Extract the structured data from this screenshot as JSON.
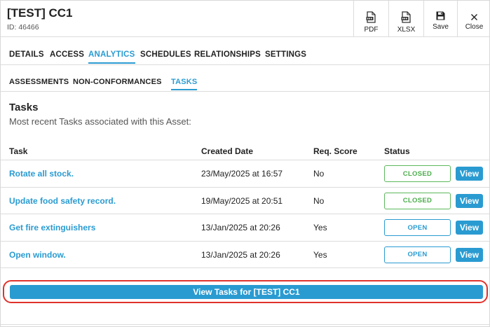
{
  "header": {
    "title": "[TEST] CC1",
    "subtitle": "ID: 46466",
    "buttons": [
      {
        "label": "PDF",
        "icon": "pdf-file-icon"
      },
      {
        "label": "XLSX",
        "icon": "xlsx-file-icon"
      },
      {
        "label": "Save",
        "icon": "save-icon"
      },
      {
        "label": "Close",
        "icon": "close-icon"
      }
    ]
  },
  "tabs": [
    {
      "label": "DETAILS"
    },
    {
      "label": "ACCESS"
    },
    {
      "label": "ANALYTICS"
    },
    {
      "label": "SCHEDULES"
    },
    {
      "label": "RELATIONSHIPS"
    },
    {
      "label": "SETTINGS"
    }
  ],
  "subtabs": [
    {
      "label": "ASSESSMENTS"
    },
    {
      "label": "NON-CONFORMANCES"
    },
    {
      "label": "TASKS"
    }
  ],
  "section": {
    "title": "Tasks",
    "description": "Most recent Tasks associated with this Asset:"
  },
  "table": {
    "headers": [
      "Task",
      "Created Date",
      "Req. Score",
      "Status"
    ],
    "rows": [
      {
        "task": "Rotate all stock.",
        "created": "23/May/2025 at 16:57",
        "req_score": "No",
        "status": "CLOSED",
        "action": "View"
      },
      {
        "task": "Update food safety record.",
        "created": "19/May/2025 at 20:51",
        "req_score": "No",
        "status": "CLOSED",
        "action": "View"
      },
      {
        "task": "Get fire extinguishers",
        "created": "13/Jan/2025 at 20:26",
        "req_score": "Yes",
        "status": "OPEN",
        "action": "View"
      },
      {
        "task": "Open window.",
        "created": "13/Jan/2025 at 20:26",
        "req_score": "Yes",
        "status": "OPEN",
        "action": "View"
      }
    ]
  },
  "bottom_button": "View Tasks for [TEST] CC1",
  "colors": {
    "accent": "#2a9bd1",
    "closed": "#5cb85c",
    "highlight": "#e0322b"
  }
}
